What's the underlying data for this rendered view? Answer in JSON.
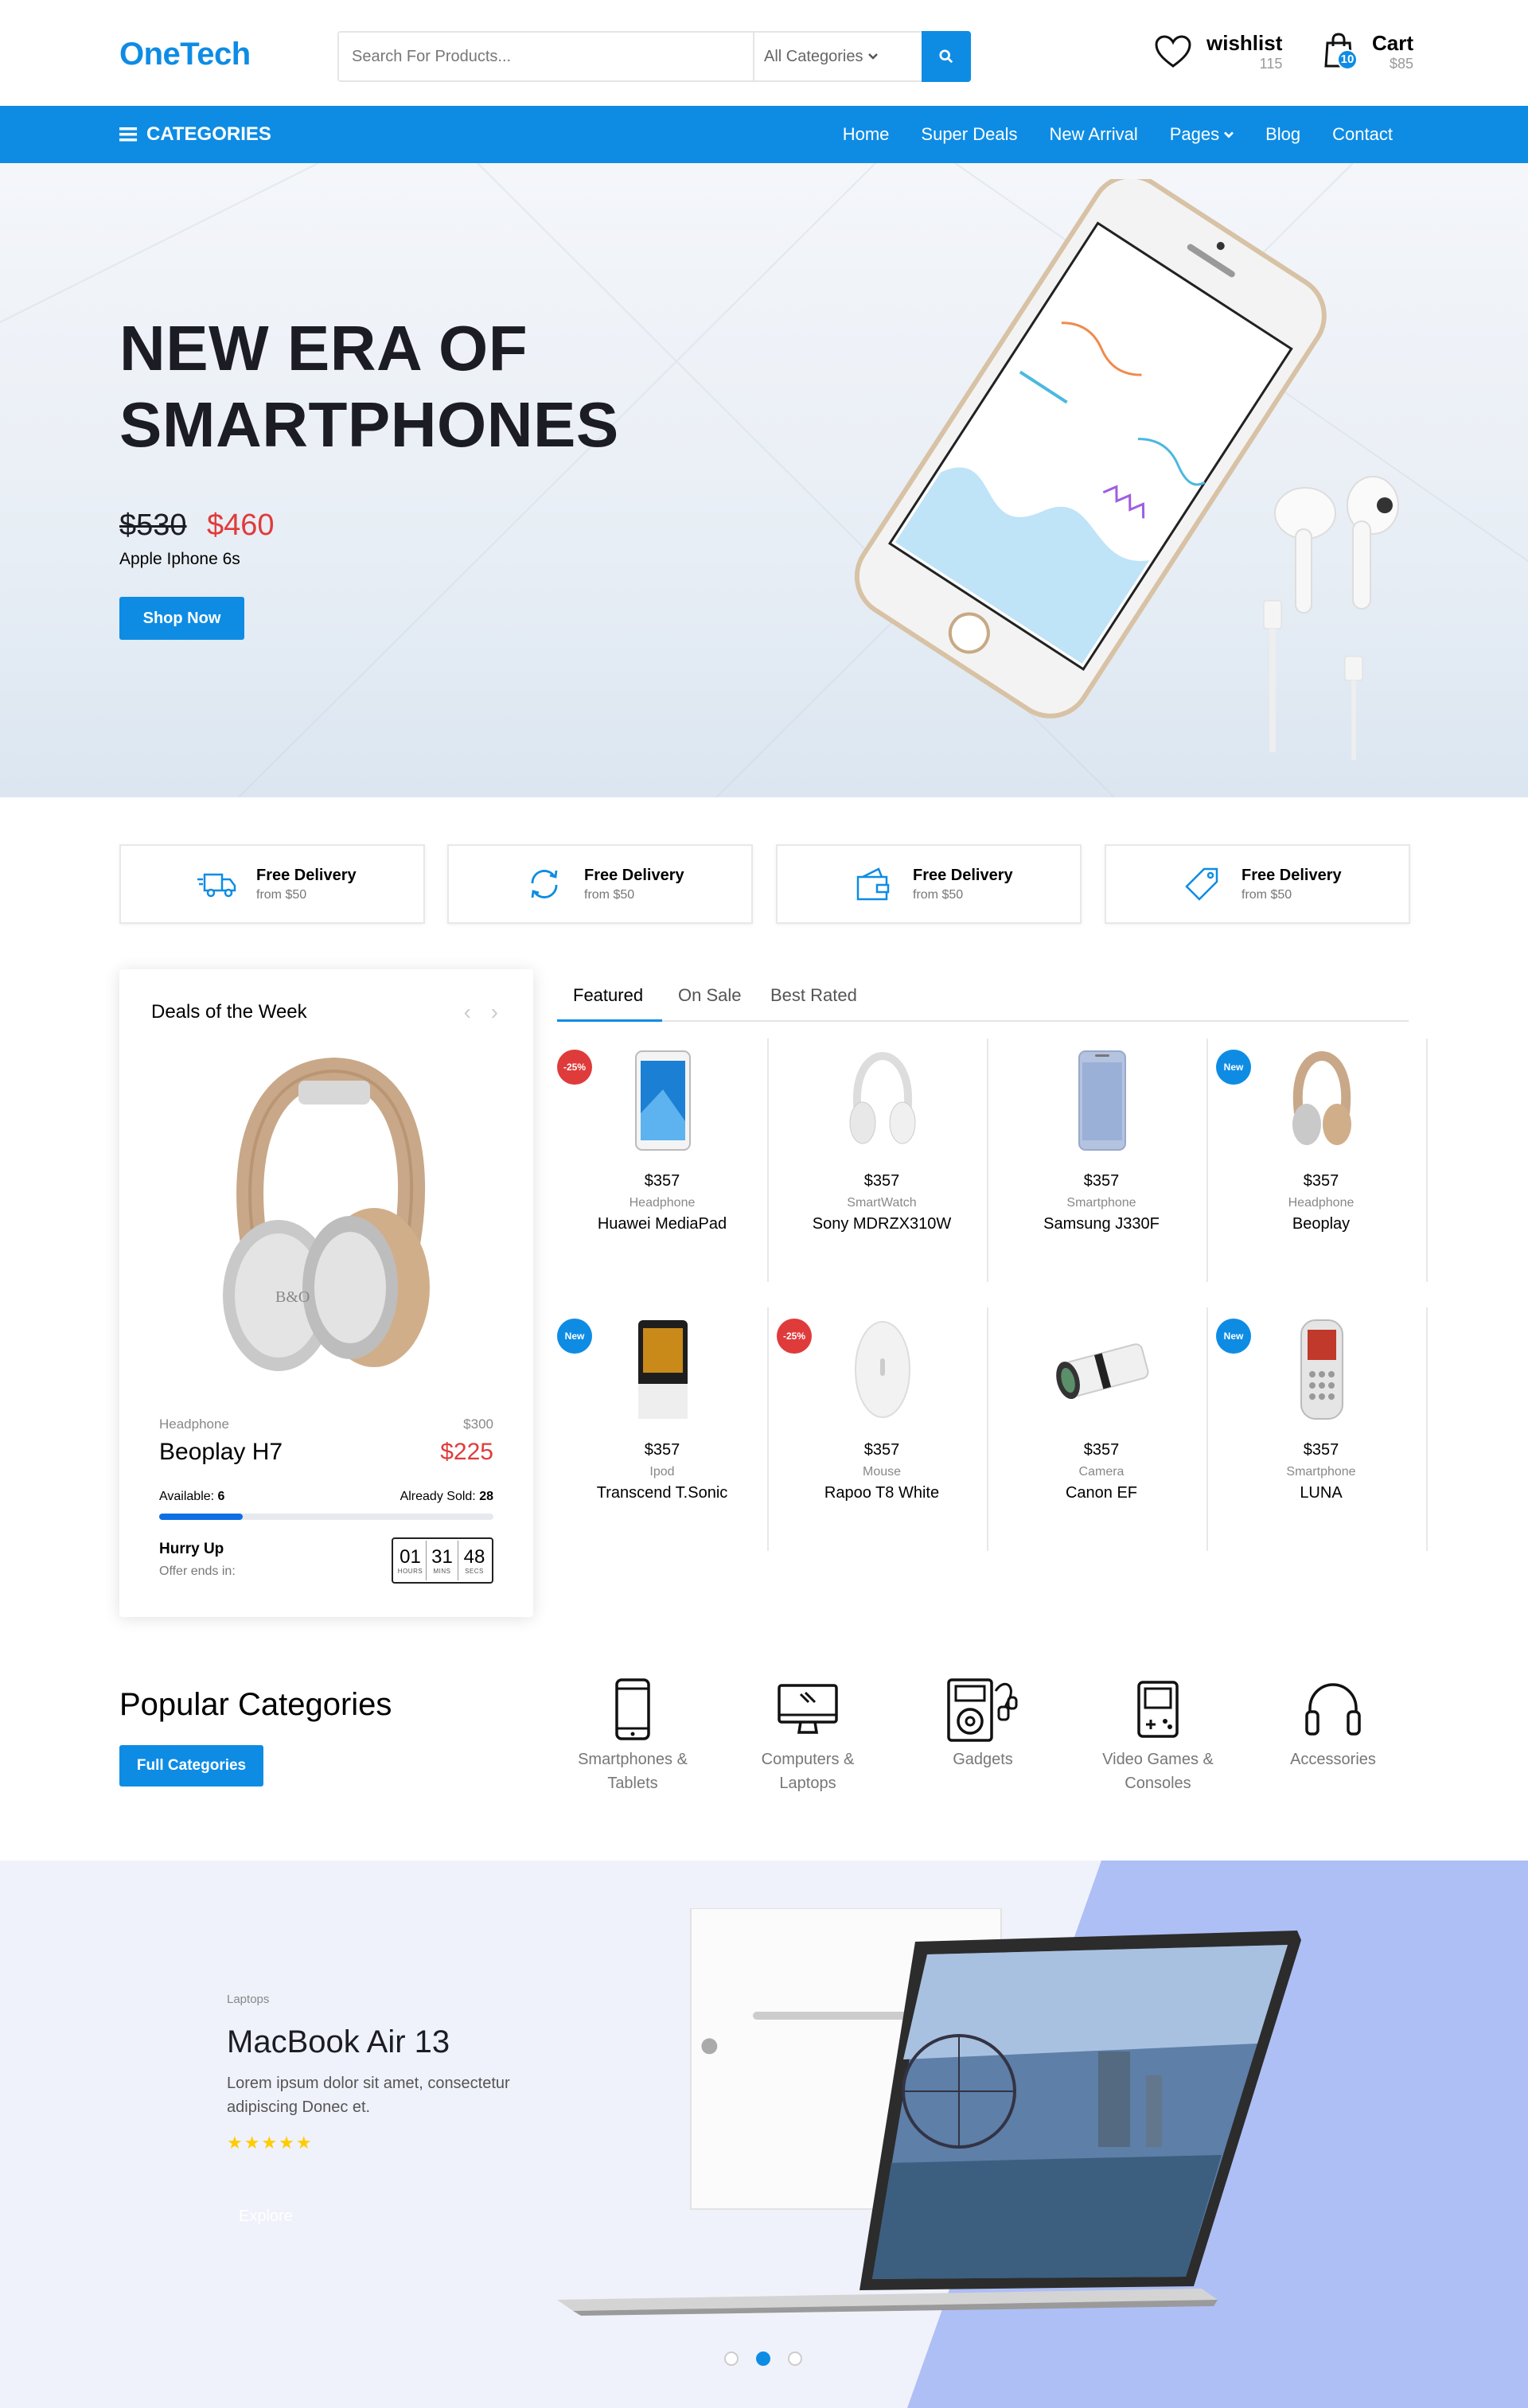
{
  "header": {
    "logo": "OneTech",
    "search_placeholder": "Search For Products...",
    "category_select": "All Categories",
    "wishlist_label": "wishlist",
    "wishlist_count": "115",
    "cart_label": "Cart",
    "cart_count": "10",
    "cart_total": "$85"
  },
  "nav": {
    "categories_label": "CATEGORIES",
    "items": [
      "Home",
      "Super Deals",
      "New Arrival",
      "Pages",
      "Blog",
      "Contact"
    ]
  },
  "hero": {
    "title_line1": "NEW ERA OF",
    "title_line2": "SMARTPHONES",
    "old_price": "$530",
    "new_price": "$460",
    "product_name": "Apple Iphone 6s",
    "button": "Shop Now"
  },
  "features": [
    {
      "title": "Free Delivery",
      "sub": "from $50",
      "icon": "truck-icon"
    },
    {
      "title": "Free Delivery",
      "sub": "from $50",
      "icon": "refresh-icon"
    },
    {
      "title": "Free Delivery",
      "sub": "from $50",
      "icon": "wallet-icon"
    },
    {
      "title": "Free Delivery",
      "sub": "from $50",
      "icon": "tag-icon"
    }
  ],
  "deals": {
    "title": "Deals of the Week",
    "category": "Headphone",
    "old_price": "$300",
    "name": "Beoplay H7",
    "price": "$225",
    "available_label": "Available:",
    "available": "6",
    "sold_label": "Already Sold:",
    "sold": "28",
    "progress": 0.25,
    "hurry": "Hurry Up",
    "offer_ends": "Offer ends in:",
    "timer": [
      {
        "n": "01",
        "l": "HOURS"
      },
      {
        "n": "31",
        "l": "MINS"
      },
      {
        "n": "48",
        "l": "SECS"
      }
    ]
  },
  "tabs": [
    "Featured",
    "On Sale",
    "Best Rated"
  ],
  "products": [
    {
      "price": "$357",
      "category": "Headphone",
      "name": "Huawei MediaPad",
      "tag": "-25%"
    },
    {
      "price": "$357",
      "category": "SmartWatch",
      "name": "Sony MDRZX310W",
      "tag": ""
    },
    {
      "price": "$357",
      "category": "Smartphone",
      "name": "Samsung J330F",
      "tag": ""
    },
    {
      "price": "$357",
      "category": "Headphone",
      "name": "Beoplay",
      "tag": "New"
    },
    {
      "price": "$357",
      "category": "Ipod",
      "name": "Transcend T.Sonic",
      "tag": "New"
    },
    {
      "price": "$357",
      "category": "Mouse",
      "name": "Rapoo T8 White",
      "tag": "-25%"
    },
    {
      "price": "$357",
      "category": "Camera",
      "name": "Canon EF",
      "tag": ""
    },
    {
      "price": "$357",
      "category": "Smartphone",
      "name": "LUNA",
      "tag": "New"
    }
  ],
  "popular": {
    "title": "Popular Categories",
    "button": "Full Categories",
    "items": [
      {
        "line1": "Smartphones &",
        "line2": "Tablets",
        "icon": "smartphone-icon"
      },
      {
        "line1": "Computers &",
        "line2": "Laptops",
        "icon": "monitor-icon"
      },
      {
        "line1": "Gadgets",
        "line2": "",
        "icon": "gadget-icon"
      },
      {
        "line1": "Video Games &",
        "line2": "Consoles",
        "icon": "gamepad-icon"
      },
      {
        "line1": "Accessories",
        "line2": "",
        "icon": "headphones-icon"
      }
    ]
  },
  "banner": {
    "category": "Laptops",
    "title": "MacBook Air 13",
    "desc": "Lorem ipsum dolor sit amet, consectetur adipiscing Donec et.",
    "stars": "★★★★★",
    "button": "Explore"
  },
  "colors": {
    "accent": "#0e8ce4",
    "sale": "#df3b3b",
    "star": "#ffcc00"
  }
}
